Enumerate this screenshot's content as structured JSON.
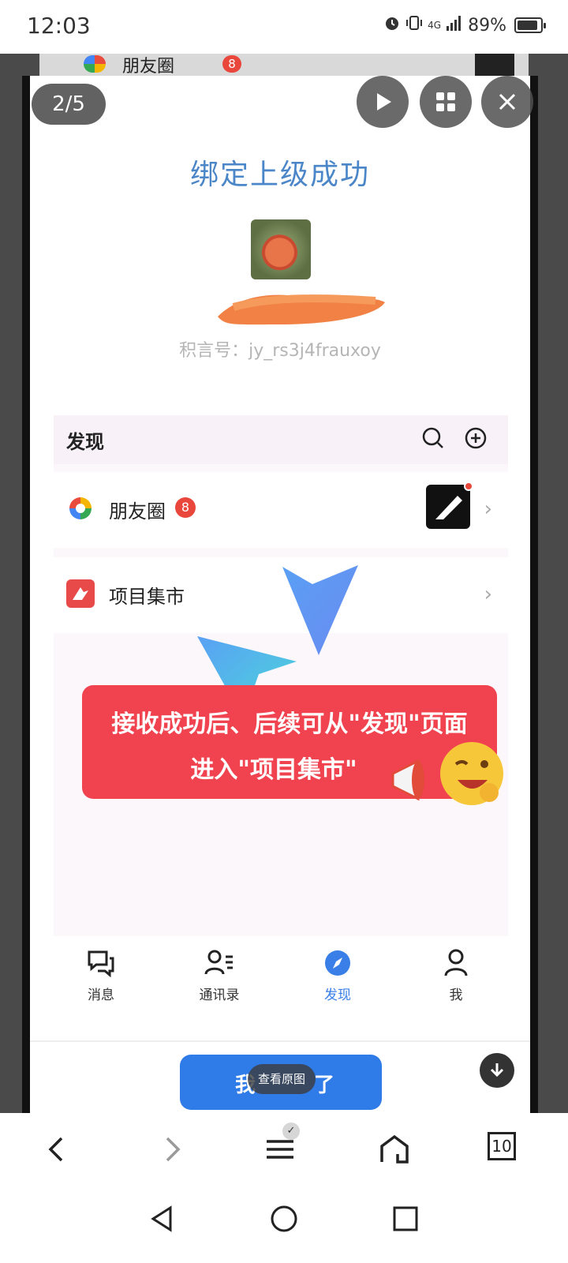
{
  "status_bar": {
    "time": "12:03",
    "network": "4G",
    "battery": "89%",
    "battery_level": 0.89
  },
  "viewer": {
    "page_counter": "2/5",
    "view_original": "查看原图",
    "controls": [
      "play-icon",
      "grid-icon",
      "close-icon",
      "download-icon"
    ]
  },
  "behind": {
    "moments_label": "朋友圈",
    "moments_badge": "8"
  },
  "screenshot": {
    "success_title": "绑定上级成功",
    "jy_id": "积言号：jy_rs3j4frauxoy",
    "discover": {
      "title": "发现",
      "icons": [
        "search-icon",
        "plus-circle-icon"
      ],
      "moments": {
        "label": "朋友圈",
        "badge": "8"
      },
      "market": {
        "label": "项目集市"
      }
    },
    "callout": {
      "line1": "接收成功后、后续可从\"发现\"页面",
      "line2": "进入\"项目集市\""
    },
    "tabs": [
      {
        "label": "消息",
        "icon": "chat-icon"
      },
      {
        "label": "通讯录",
        "icon": "contacts-icon"
      },
      {
        "label": "发现",
        "icon": "compass-icon",
        "active": true
      },
      {
        "label": "我",
        "icon": "person-icon"
      }
    ],
    "blue_button_partial": [
      "我",
      "了"
    ],
    "accent_color": "#3a7ee8",
    "callout_color": "#f0434f"
  },
  "browser_toolbar": {
    "tab_count": "10",
    "icons": [
      "back-icon",
      "forward-icon",
      "menu-icon",
      "home-icon",
      "tabs-icon"
    ]
  },
  "system_nav": {
    "icons": [
      "nav-back-icon",
      "nav-home-icon",
      "nav-recent-icon"
    ]
  }
}
